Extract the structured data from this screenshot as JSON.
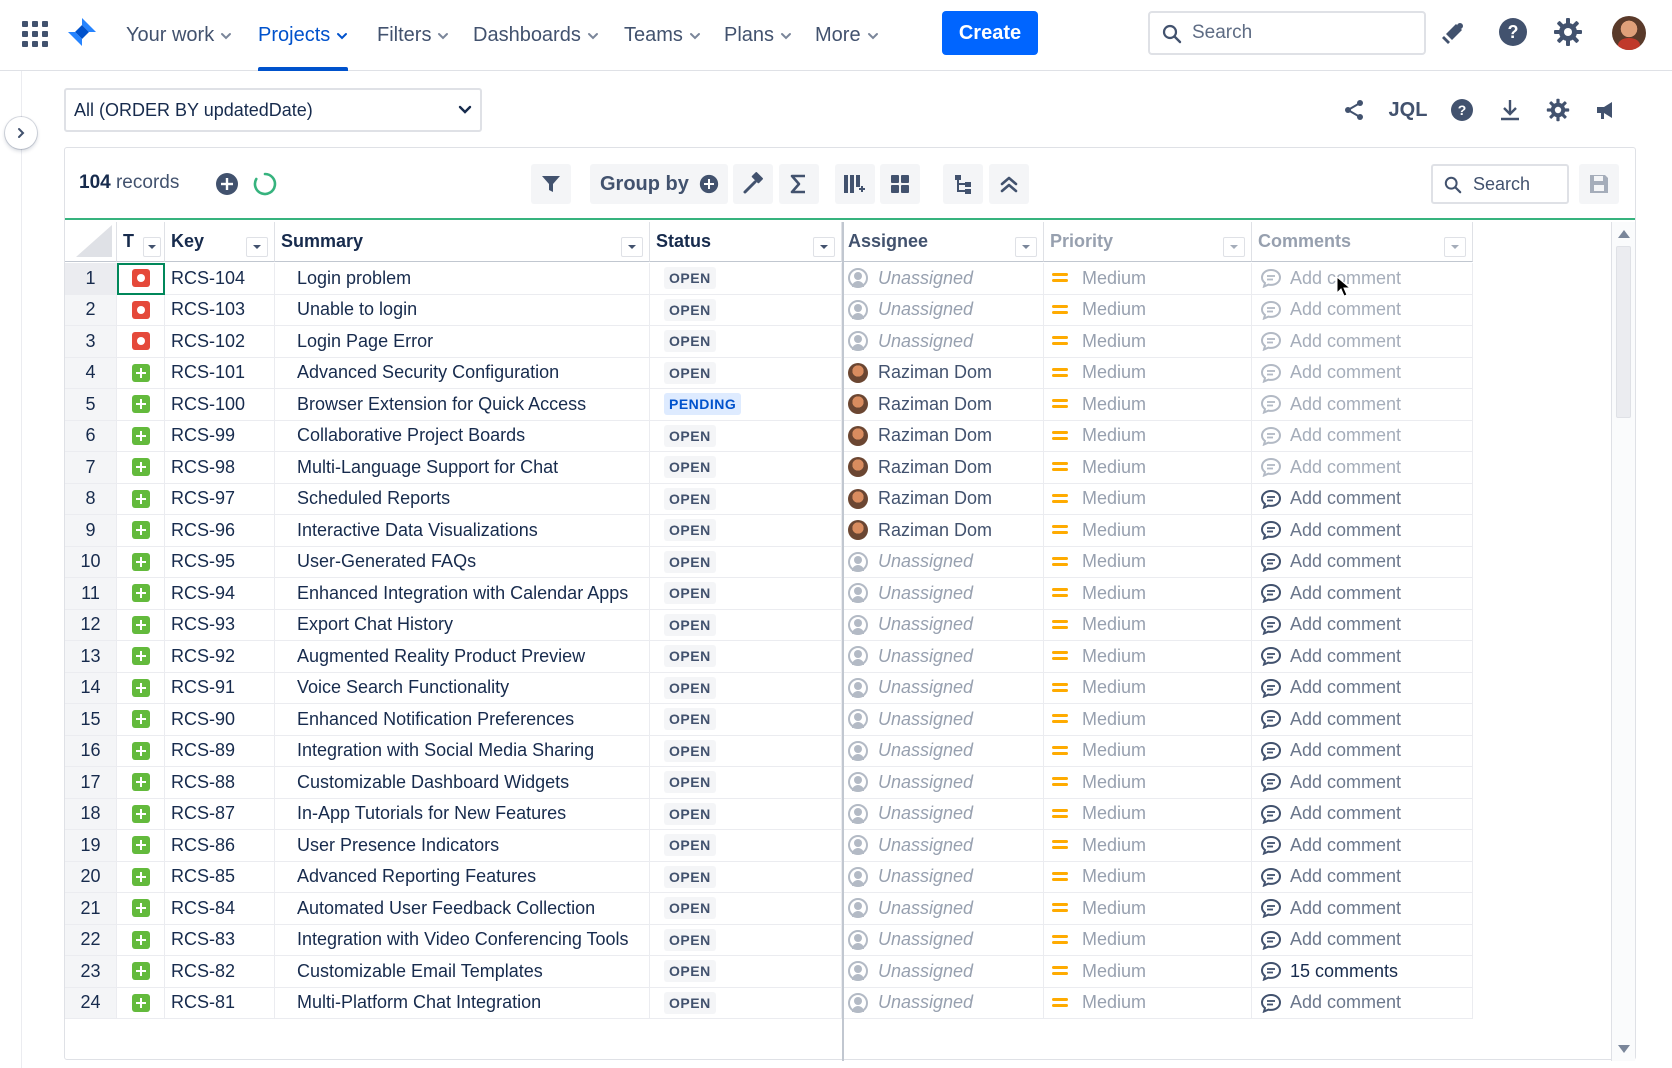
{
  "nav": {
    "items": [
      {
        "label": "Your work"
      },
      {
        "label": "Projects"
      },
      {
        "label": "Filters"
      },
      {
        "label": "Dashboards"
      },
      {
        "label": "Teams"
      },
      {
        "label": "Plans"
      },
      {
        "label": "More"
      }
    ],
    "active": "Projects",
    "create_label": "Create",
    "search_placeholder": "Search"
  },
  "filter": {
    "selected": "All (ORDER BY updatedDate)",
    "jql_label": "JQL"
  },
  "toolbar": {
    "records_count": "104",
    "records_label": "records",
    "group_by_label": "Group by",
    "search_placeholder": "Search"
  },
  "columns": [
    "T",
    "Key",
    "Summary",
    "Status",
    "Assignee",
    "Priority",
    "Comments"
  ],
  "rows": [
    {
      "n": "1",
      "type": "bug",
      "key": "RCS-104",
      "summary": "Login problem",
      "status": "OPEN",
      "assignee": "Unassigned",
      "priority": "Medium",
      "comments": "Add comment"
    },
    {
      "n": "2",
      "type": "bug",
      "key": "RCS-103",
      "summary": "Unable to login",
      "status": "OPEN",
      "assignee": "Unassigned",
      "priority": "Medium",
      "comments": "Add comment"
    },
    {
      "n": "3",
      "type": "bug",
      "key": "RCS-102",
      "summary": "Login Page Error",
      "status": "OPEN",
      "assignee": "Unassigned",
      "priority": "Medium",
      "comments": "Add comment"
    },
    {
      "n": "4",
      "type": "story",
      "key": "RCS-101",
      "summary": "Advanced Security Configuration",
      "status": "OPEN",
      "assignee": "Raziman Dom",
      "priority": "Medium",
      "comments": "Add comment"
    },
    {
      "n": "5",
      "type": "story",
      "key": "RCS-100",
      "summary": "Browser Extension for Quick Access",
      "status": "PENDING",
      "assignee": "Raziman Dom",
      "priority": "Medium",
      "comments": "Add comment"
    },
    {
      "n": "6",
      "type": "story",
      "key": "RCS-99",
      "summary": "Collaborative Project Boards",
      "status": "OPEN",
      "assignee": "Raziman Dom",
      "priority": "Medium",
      "comments": "Add comment"
    },
    {
      "n": "7",
      "type": "story",
      "key": "RCS-98",
      "summary": "Multi-Language Support for Chat",
      "status": "OPEN",
      "assignee": "Raziman Dom",
      "priority": "Medium",
      "comments": "Add comment"
    },
    {
      "n": "8",
      "type": "story",
      "key": "RCS-97",
      "summary": "Scheduled Reports",
      "status": "OPEN",
      "assignee": "Raziman Dom",
      "priority": "Medium",
      "comments": "Add comment"
    },
    {
      "n": "9",
      "type": "story",
      "key": "RCS-96",
      "summary": "Interactive Data Visualizations",
      "status": "OPEN",
      "assignee": "Raziman Dom",
      "priority": "Medium",
      "comments": "Add comment"
    },
    {
      "n": "10",
      "type": "story",
      "key": "RCS-95",
      "summary": "User-Generated FAQs",
      "status": "OPEN",
      "assignee": "Unassigned",
      "priority": "Medium",
      "comments": "Add comment"
    },
    {
      "n": "11",
      "type": "story",
      "key": "RCS-94",
      "summary": "Enhanced Integration with Calendar Apps",
      "status": "OPEN",
      "assignee": "Unassigned",
      "priority": "Medium",
      "comments": "Add comment"
    },
    {
      "n": "12",
      "type": "story",
      "key": "RCS-93",
      "summary": "Export Chat History",
      "status": "OPEN",
      "assignee": "Unassigned",
      "priority": "Medium",
      "comments": "Add comment"
    },
    {
      "n": "13",
      "type": "story",
      "key": "RCS-92",
      "summary": "Augmented Reality Product Preview",
      "status": "OPEN",
      "assignee": "Unassigned",
      "priority": "Medium",
      "comments": "Add comment"
    },
    {
      "n": "14",
      "type": "story",
      "key": "RCS-91",
      "summary": "Voice Search Functionality",
      "status": "OPEN",
      "assignee": "Unassigned",
      "priority": "Medium",
      "comments": "Add comment"
    },
    {
      "n": "15",
      "type": "story",
      "key": "RCS-90",
      "summary": "Enhanced Notification Preferences",
      "status": "OPEN",
      "assignee": "Unassigned",
      "priority": "Medium",
      "comments": "Add comment"
    },
    {
      "n": "16",
      "type": "story",
      "key": "RCS-89",
      "summary": "Integration with Social Media Sharing",
      "status": "OPEN",
      "assignee": "Unassigned",
      "priority": "Medium",
      "comments": "Add comment"
    },
    {
      "n": "17",
      "type": "story",
      "key": "RCS-88",
      "summary": "Customizable Dashboard Widgets",
      "status": "OPEN",
      "assignee": "Unassigned",
      "priority": "Medium",
      "comments": "Add comment"
    },
    {
      "n": "18",
      "type": "story",
      "key": "RCS-87",
      "summary": "In-App Tutorials for New Features",
      "status": "OPEN",
      "assignee": "Unassigned",
      "priority": "Medium",
      "comments": "Add comment"
    },
    {
      "n": "19",
      "type": "story",
      "key": "RCS-86",
      "summary": "User Presence Indicators",
      "status": "OPEN",
      "assignee": "Unassigned",
      "priority": "Medium",
      "comments": "Add comment"
    },
    {
      "n": "20",
      "type": "story",
      "key": "RCS-85",
      "summary": "Advanced Reporting Features",
      "status": "OPEN",
      "assignee": "Unassigned",
      "priority": "Medium",
      "comments": "Add comment"
    },
    {
      "n": "21",
      "type": "story",
      "key": "RCS-84",
      "summary": "Automated User Feedback Collection",
      "status": "OPEN",
      "assignee": "Unassigned",
      "priority": "Medium",
      "comments": "Add comment"
    },
    {
      "n": "22",
      "type": "story",
      "key": "RCS-83",
      "summary": "Integration with Video Conferencing Tools",
      "status": "OPEN",
      "assignee": "Unassigned",
      "priority": "Medium",
      "comments": "Add comment"
    },
    {
      "n": "23",
      "type": "story",
      "key": "RCS-82",
      "summary": "Customizable Email Templates",
      "status": "OPEN",
      "assignee": "Unassigned",
      "priority": "Medium",
      "comments": "15 comments"
    },
    {
      "n": "24",
      "type": "story",
      "key": "RCS-81",
      "summary": "Multi-Platform Chat Integration",
      "status": "OPEN",
      "assignee": "Unassigned",
      "priority": "Medium",
      "comments": "Add comment"
    }
  ],
  "colors": {
    "brand": "#0052cc",
    "create": "#0065ff",
    "accent_line": "#36b37e",
    "bug": "#e5493a",
    "story": "#63ba3c",
    "priority_medium": "#ffab00"
  }
}
